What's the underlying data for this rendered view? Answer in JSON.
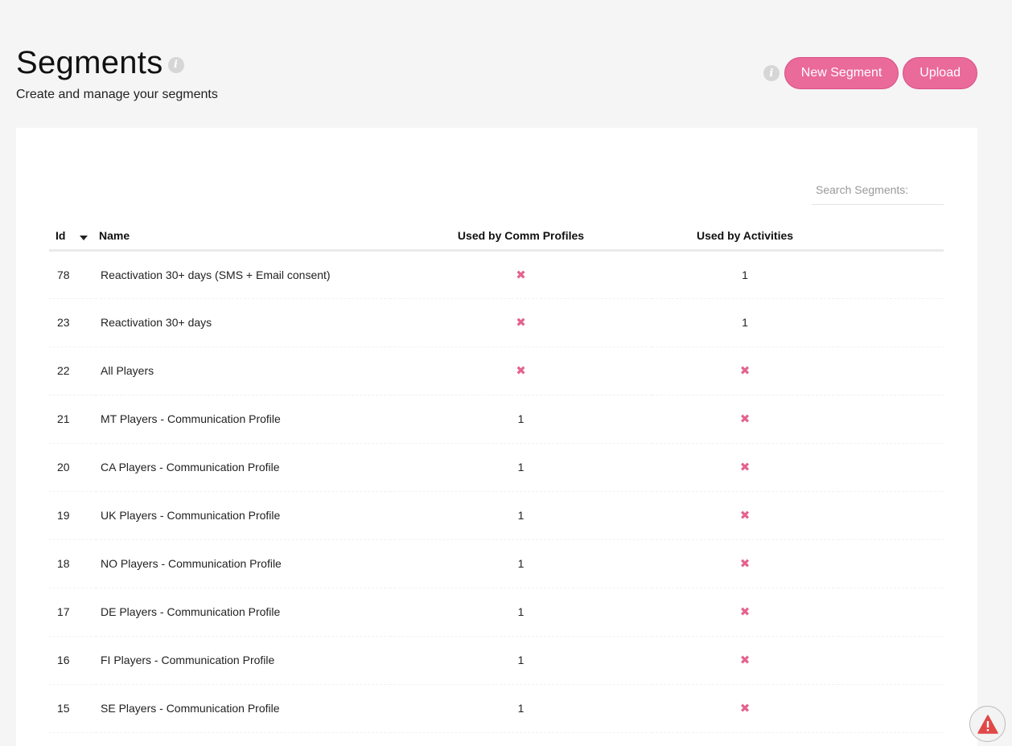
{
  "header": {
    "title": "Segments",
    "subtitle": "Create and manage your segments",
    "info_glyph": "i"
  },
  "actions": {
    "new_segment_label": "New Segment",
    "upload_label": "Upload"
  },
  "search": {
    "placeholder": "Search Segments:"
  },
  "table": {
    "columns": {
      "id": "Id",
      "name": "Name",
      "comm_profiles": "Used by Comm Profiles",
      "activities": "Used by Activities"
    },
    "rows": [
      {
        "id": "78",
        "name": "Reactivation 30+ days (SMS + Email consent)",
        "comm": "✖",
        "act": "1"
      },
      {
        "id": "23",
        "name": "Reactivation 30+ days",
        "comm": "✖",
        "act": "1"
      },
      {
        "id": "22",
        "name": "All Players",
        "comm": "✖",
        "act": "✖"
      },
      {
        "id": "21",
        "name": "MT Players - Communication Profile",
        "comm": "1",
        "act": "✖"
      },
      {
        "id": "20",
        "name": "CA Players - Communication Profile",
        "comm": "1",
        "act": "✖"
      },
      {
        "id": "19",
        "name": "UK Players - Communication Profile",
        "comm": "1",
        "act": "✖"
      },
      {
        "id": "18",
        "name": "NO Players - Communication Profile",
        "comm": "1",
        "act": "✖"
      },
      {
        "id": "17",
        "name": "DE Players - Communication Profile",
        "comm": "1",
        "act": "✖"
      },
      {
        "id": "16",
        "name": "FI Players - Communication Profile",
        "comm": "1",
        "act": "✖"
      },
      {
        "id": "15",
        "name": "SE Players - Communication Profile",
        "comm": "1",
        "act": "✖"
      }
    ]
  },
  "icons": {
    "info": "info-icon",
    "sort": "sort-desc-icon",
    "not_used": "x-icon",
    "alert": "warning-icon"
  },
  "colors": {
    "accent": "#ea6a9a",
    "x_mark": "#e3648f",
    "alert": "#e04848"
  }
}
